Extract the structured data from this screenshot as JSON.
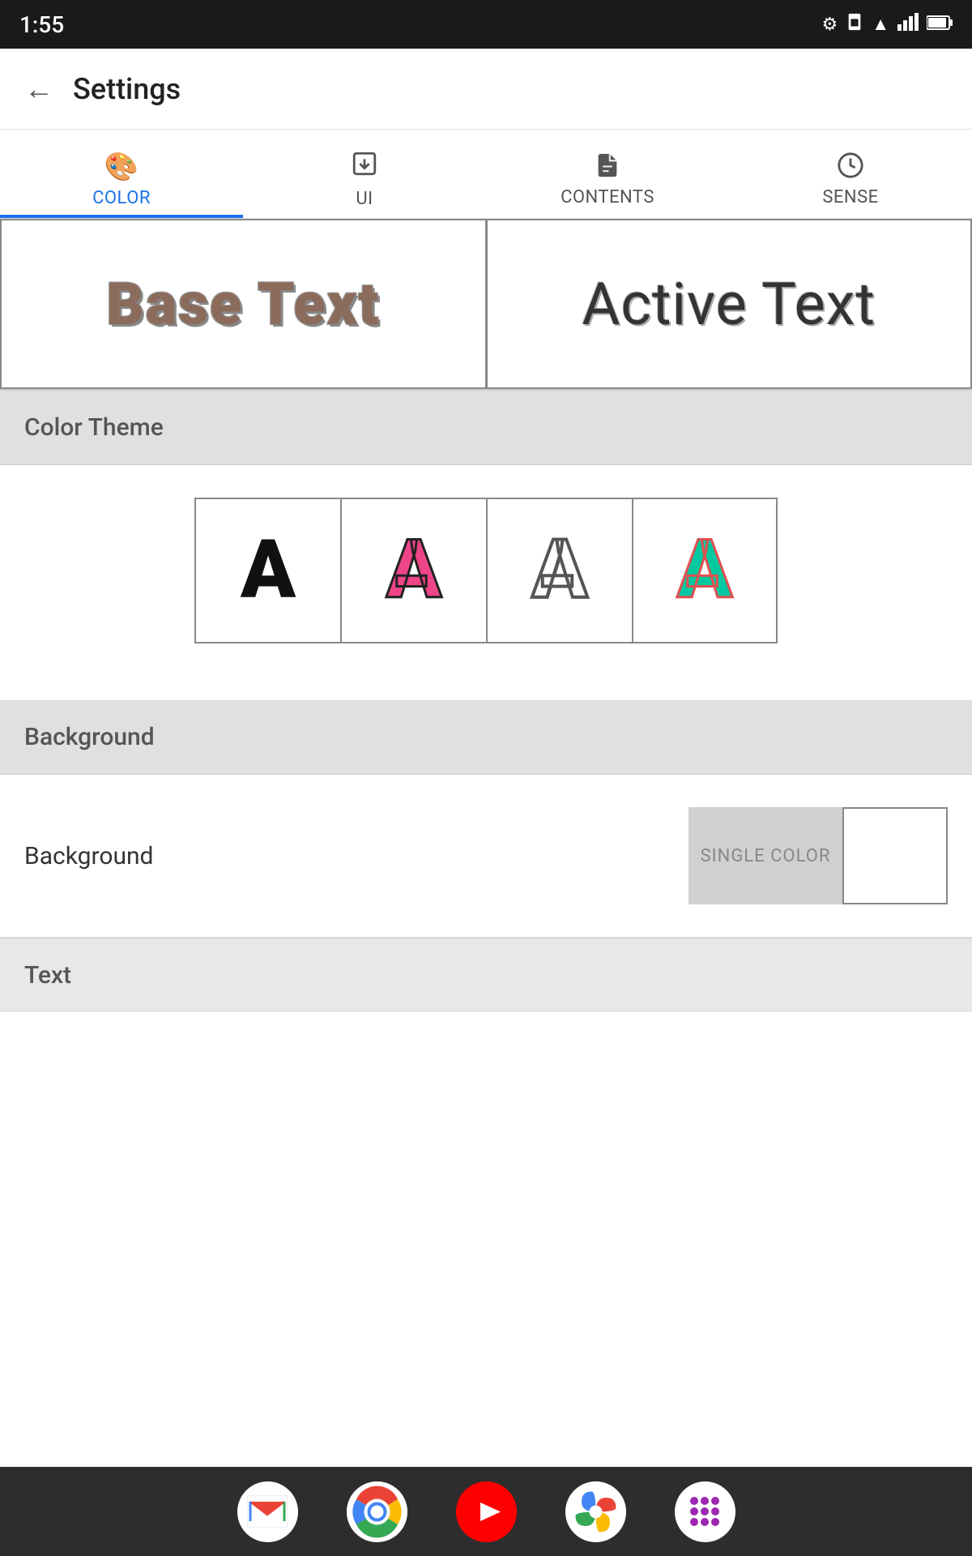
{
  "statusBar": {
    "time": "1:55",
    "icons": [
      "settings",
      "sim",
      "wifi",
      "signal",
      "battery"
    ]
  },
  "header": {
    "backLabel": "←",
    "title": "Settings"
  },
  "tabs": [
    {
      "id": "color",
      "label": "COLOR",
      "icon": "🎨",
      "active": true
    },
    {
      "id": "ui",
      "label": "UI",
      "icon": "⬇",
      "active": false
    },
    {
      "id": "contents",
      "label": "CONTENTS",
      "icon": "📄",
      "active": false
    },
    {
      "id": "sense",
      "label": "SENSE",
      "icon": "⏱",
      "active": false
    }
  ],
  "preview": {
    "baseText": "Base Text",
    "activeText": "Active Text"
  },
  "sections": {
    "colorTheme": {
      "title": "Color Theme",
      "options": [
        {
          "letter": "A",
          "style": "black"
        },
        {
          "letter": "A",
          "style": "pink"
        },
        {
          "letter": "A",
          "style": "outline"
        },
        {
          "letter": "A",
          "style": "teal"
        }
      ]
    },
    "background": {
      "title": "Background",
      "label": "Background",
      "singleColorLabel": "SINGLE COLOR",
      "whiteBox": ""
    },
    "text": {
      "title": "Text"
    }
  },
  "bottomNav": {
    "apps": [
      {
        "name": "gmail",
        "label": "Gmail"
      },
      {
        "name": "chrome",
        "label": "Chrome"
      },
      {
        "name": "youtube",
        "label": "YouTube"
      },
      {
        "name": "photos",
        "label": "Photos"
      },
      {
        "name": "apps",
        "label": "Apps"
      }
    ]
  }
}
